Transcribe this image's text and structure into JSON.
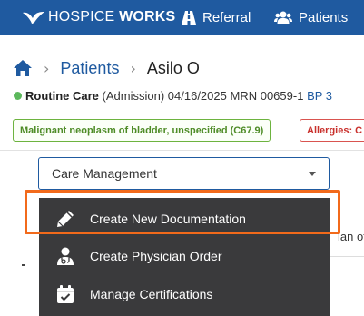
{
  "brand": {
    "name_light": "HOSPICE ",
    "name_bold": "WORKS",
    "logo_icon": "bird-logo-icon"
  },
  "nav": {
    "referral": "Referral",
    "patients": "Patients"
  },
  "breadcrumb": {
    "home_icon": "home-icon",
    "patients": "Patients",
    "current": "Asilo O"
  },
  "status": {
    "care_level": "Routine Care",
    "admission": "(Admission)",
    "date": "04/16/2025",
    "mrn_label": "MRN",
    "mrn": "00659-1",
    "bp": "BP 3",
    "dot_color": "#5cb85c"
  },
  "tags": {
    "diagnosis": "Malignant neoplasm of bladder, unspecified (C67.9)",
    "allergies": "Allergies: C"
  },
  "select": {
    "value": "Care Management"
  },
  "background": {
    "partial_text": "lan of"
  },
  "menu": {
    "items": [
      {
        "label": "Create New Documentation",
        "icon": "pencil-icon"
      },
      {
        "label": "Create Physician Order",
        "icon": "physician-icon"
      },
      {
        "label": "Manage Certifications",
        "icon": "calendar-check-icon"
      }
    ]
  },
  "colors": {
    "nav_bg": "#1f5aa0",
    "menu_bg": "#3a3a3c",
    "highlight": "#f26a1b",
    "dx_green": "#4e8c27",
    "allergy_red": "#c9302c"
  }
}
